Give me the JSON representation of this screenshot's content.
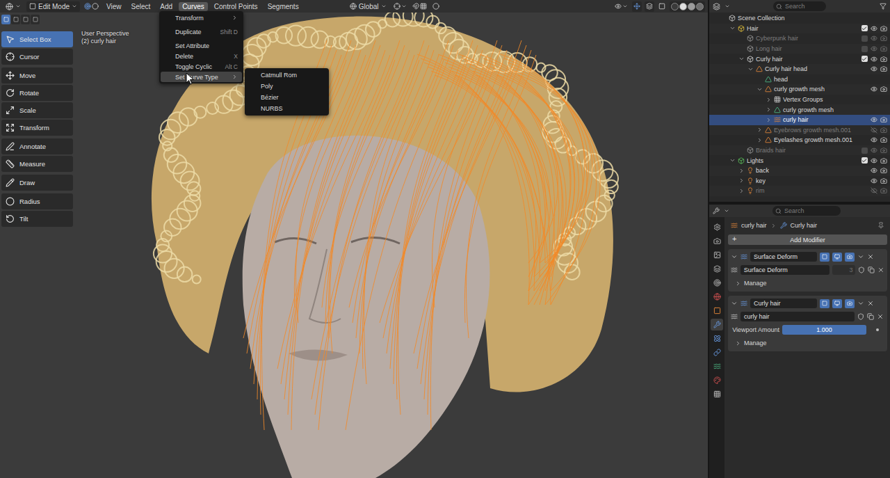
{
  "header": {
    "mode": "Edit Mode",
    "menus": [
      {
        "label": "View",
        "selected": false
      },
      {
        "label": "Select",
        "selected": false
      },
      {
        "label": "Add",
        "selected": false
      },
      {
        "label": "Curves",
        "selected": true
      },
      {
        "label": "Control Points",
        "selected": false
      },
      {
        "label": "Segments",
        "selected": false
      }
    ],
    "orientation": "Global"
  },
  "toolbar": {
    "groups": [
      [
        {
          "label": "Select Box",
          "selected": true
        },
        {
          "label": "Cursor",
          "selected": false
        }
      ],
      [
        {
          "label": "Move",
          "selected": false
        },
        {
          "label": "Rotate",
          "selected": false
        },
        {
          "label": "Scale",
          "selected": false
        },
        {
          "label": "Transform",
          "selected": false
        }
      ],
      [
        {
          "label": "Annotate",
          "selected": false
        },
        {
          "label": "Measure",
          "selected": false
        }
      ],
      [
        {
          "label": "Draw",
          "selected": false
        }
      ],
      [
        {
          "label": "Radius",
          "selected": false
        },
        {
          "label": "Tilt",
          "selected": false
        }
      ]
    ]
  },
  "viewport": {
    "view_name": "User Perspective",
    "object_info": "(2) curly hair"
  },
  "curves_menu": {
    "items": [
      {
        "label": "Transform",
        "shortcut": "",
        "submenu": true,
        "separator_before": false,
        "selected": false
      },
      {
        "label": "Duplicate",
        "shortcut": "Shift D",
        "submenu": false,
        "separator_before": true,
        "selected": false
      },
      {
        "label": "Set Attribute",
        "shortcut": "",
        "submenu": false,
        "separator_before": true,
        "selected": false
      },
      {
        "label": "Delete",
        "shortcut": "X",
        "submenu": false,
        "separator_before": false,
        "selected": false
      },
      {
        "label": "Toggle Cyclic",
        "shortcut": "Alt C",
        "submenu": false,
        "separator_before": false,
        "selected": false
      },
      {
        "label": "Set Curve Type",
        "shortcut": "",
        "submenu": true,
        "separator_before": false,
        "selected": true
      }
    ]
  },
  "curve_type_menu": {
    "items": [
      "Catmull Rom",
      "Poly",
      "Bézier",
      "NURBS"
    ]
  },
  "outliner": {
    "search_placeholder": "Search",
    "rows": [
      {
        "label": "Scene Collection",
        "depth": 0,
        "kind": "scene",
        "expandable": false,
        "expanded": false,
        "selected": false,
        "disabled": false
      },
      {
        "label": "Hair",
        "depth": 1,
        "kind": "collection",
        "color": "#e8c53a",
        "expandable": true,
        "expanded": true,
        "selected": false,
        "disabled": false,
        "checked": true,
        "visible": true
      },
      {
        "label": "Cyberpunk hair",
        "depth": 2,
        "kind": "collection",
        "color": "#9a9a9a",
        "expandable": false,
        "expanded": false,
        "selected": false,
        "disabled": true,
        "checked": false,
        "visible": true
      },
      {
        "label": "Long hair",
        "depth": 2,
        "kind": "collection",
        "color": "#9a9a9a",
        "expandable": false,
        "expanded": false,
        "selected": false,
        "disabled": true,
        "checked": false,
        "visible": true
      },
      {
        "label": "Curly hair",
        "depth": 2,
        "kind": "collection",
        "color": "#d8d8d8",
        "expandable": true,
        "expanded": true,
        "selected": false,
        "disabled": false,
        "checked": true,
        "visible": true
      },
      {
        "label": "Curly hair head",
        "depth": 3,
        "kind": "mesh_object",
        "expandable": true,
        "expanded": true,
        "selected": false,
        "disabled": false,
        "visible": true
      },
      {
        "label": "head",
        "depth": 4,
        "kind": "mesh_data",
        "expandable": false,
        "expanded": false,
        "selected": false,
        "disabled": false
      },
      {
        "label": "curly growth mesh",
        "depth": 4,
        "kind": "mesh_object",
        "expandable": true,
        "expanded": true,
        "selected": false,
        "disabled": false,
        "visible": true
      },
      {
        "label": "Vertex Groups",
        "depth": 5,
        "kind": "vertex_groups",
        "expandable": true,
        "expanded": false,
        "selected": false,
        "disabled": false
      },
      {
        "label": "curly growth mesh",
        "depth": 5,
        "kind": "mesh_data",
        "expandable": true,
        "expanded": false,
        "selected": false,
        "disabled": false
      },
      {
        "label": "curly hair",
        "depth": 5,
        "kind": "curves_object",
        "expandable": true,
        "expanded": false,
        "selected": true,
        "disabled": false,
        "visible": true
      },
      {
        "label": "Eyebrows growth mesh.001",
        "depth": 4,
        "kind": "mesh_object",
        "expandable": true,
        "expanded": false,
        "selected": false,
        "disabled": true,
        "visible": false
      },
      {
        "label": "Eyelashes growth mesh.001",
        "depth": 4,
        "kind": "mesh_object",
        "expandable": true,
        "expanded": false,
        "selected": false,
        "disabled": false,
        "visible": true
      },
      {
        "label": "Braids hair",
        "depth": 2,
        "kind": "collection",
        "color": "#9a9a9a",
        "expandable": false,
        "expanded": false,
        "selected": false,
        "disabled": true,
        "checked": false,
        "visible": true
      },
      {
        "label": "Lights",
        "depth": 1,
        "kind": "collection",
        "color": "#5cc45c",
        "expandable": true,
        "expanded": true,
        "selected": false,
        "disabled": false,
        "checked": true,
        "visible": true
      },
      {
        "label": "back",
        "depth": 2,
        "kind": "light",
        "expandable": true,
        "expanded": false,
        "selected": false,
        "disabled": false,
        "visible": true
      },
      {
        "label": "key",
        "depth": 2,
        "kind": "light",
        "expandable": true,
        "expanded": false,
        "selected": false,
        "disabled": false,
        "visible": true
      },
      {
        "label": "rim",
        "depth": 2,
        "kind": "light",
        "expandable": true,
        "expanded": false,
        "selected": false,
        "disabled": true,
        "visible": false
      }
    ]
  },
  "properties": {
    "search_placeholder": "Search",
    "tabs": [
      {
        "selected": false
      },
      {
        "selected": false
      },
      {
        "selected": false
      },
      {
        "selected": false
      },
      {
        "selected": false
      },
      {
        "selected": false
      },
      {
        "selected": false
      },
      {
        "selected": true
      },
      {
        "selected": false
      },
      {
        "selected": false
      },
      {
        "selected": false
      },
      {
        "selected": false
      },
      {
        "selected": false
      }
    ],
    "breadcrumb": [
      "curly hair",
      "Curly hair"
    ],
    "add_button": "Add Modifier",
    "modifiers": [
      {
        "name": "Surface Deform",
        "expanded": true,
        "node_group": "Surface Deform",
        "users": "3",
        "inputs": [],
        "manage": {
          "label": "Manage",
          "expanded": false
        }
      },
      {
        "name": "Curly hair",
        "expanded": true,
        "node_group": "curly hair",
        "inputs": [
          {
            "label": "Viewport Amount",
            "value": "1.000",
            "level": 1
          }
        ],
        "manage": {
          "label": "Manage",
          "expanded": false
        }
      }
    ]
  }
}
